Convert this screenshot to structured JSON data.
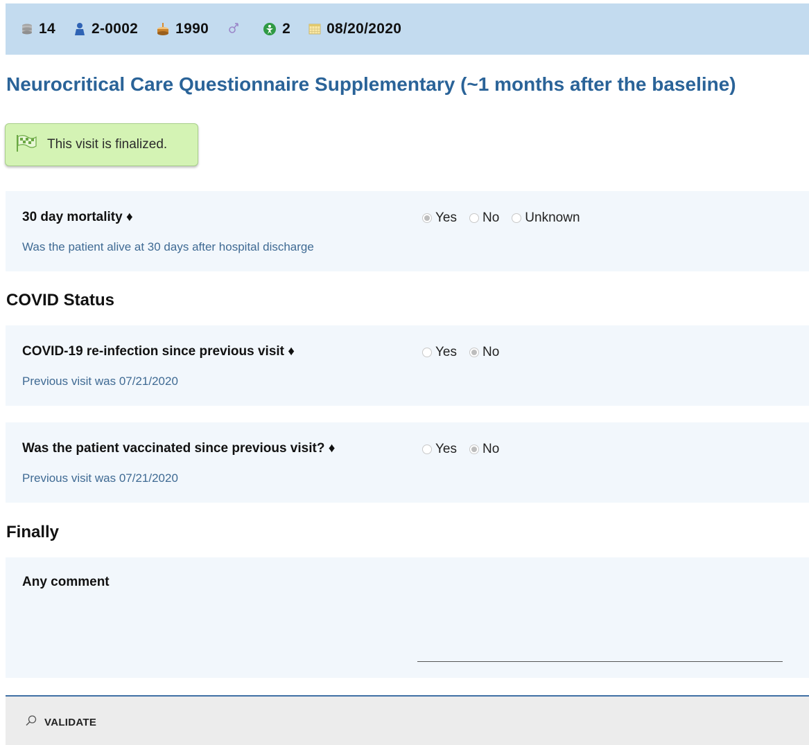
{
  "header": {
    "visit_number": "14",
    "patient_id": "2-0002",
    "birth_year": "1990",
    "group": "2",
    "visit_date": "08/20/2020"
  },
  "page_title": "Neurocritical Care Questionnaire Supplementary (~1 months after the baseline)",
  "status_badge": {
    "text": "This visit is finalized."
  },
  "questions": {
    "mortality": {
      "label": "30 day mortality ♦",
      "help": "Was the patient alive at 30 days after hospital discharge",
      "options": [
        "Yes",
        "No",
        "Unknown"
      ],
      "selected": "Yes"
    },
    "reinfection": {
      "label": "COVID-19 re-infection since previous visit ♦",
      "help": "Previous visit was 07/21/2020",
      "options": [
        "Yes",
        "No"
      ],
      "selected": "No"
    },
    "vaccinated": {
      "label": "Was the patient vaccinated since previous visit? ♦",
      "help": "Previous visit was 07/21/2020",
      "options": [
        "Yes",
        "No"
      ],
      "selected": "No"
    },
    "comment": {
      "label": "Any comment",
      "value": ""
    }
  },
  "sections": {
    "covid": "COVID Status",
    "finally": "Finally"
  },
  "footer": {
    "validate_label": "VALIDATE"
  },
  "colors": {
    "header_bg": "#c3dbef",
    "title": "#2a6398",
    "card_bg": "#f2f7fc",
    "badge_bg": "#d4f3b4",
    "help_text": "#3f6a93"
  }
}
